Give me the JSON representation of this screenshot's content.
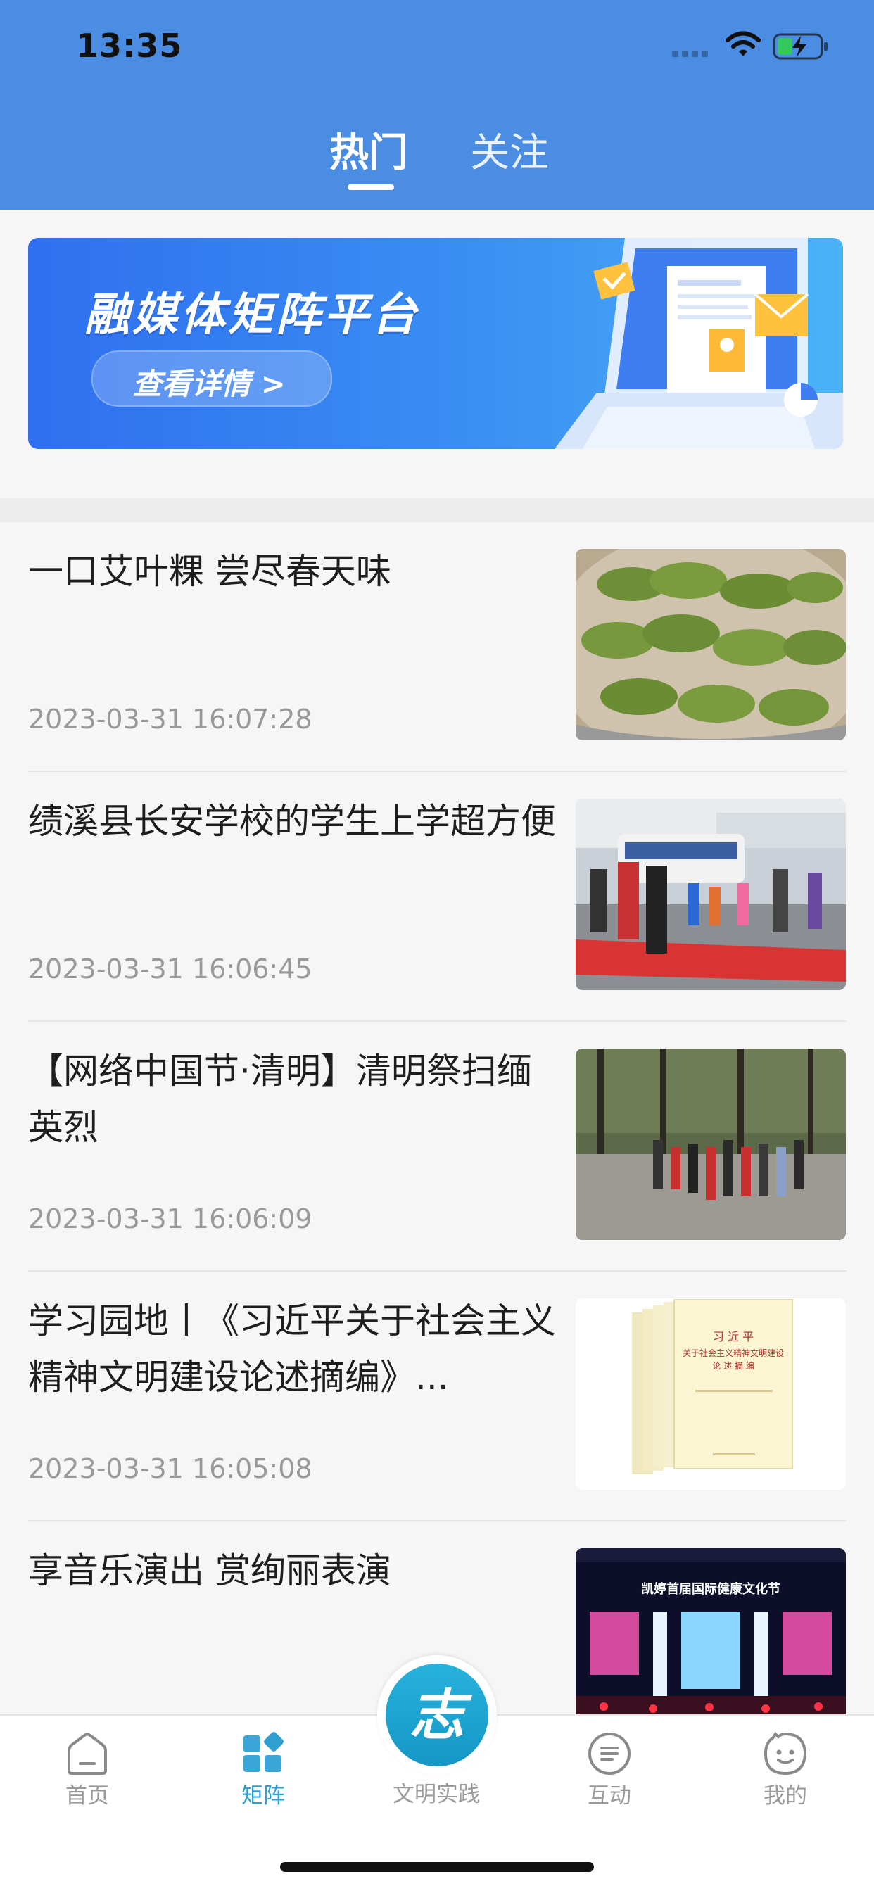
{
  "status": {
    "time": "13:35"
  },
  "header": {
    "tabs": [
      {
        "label": "热门"
      },
      {
        "label": "关注"
      }
    ],
    "active_tab": "热门"
  },
  "banner": {
    "title": "融媒体矩阵平台",
    "button": "查看详情 >"
  },
  "feed": [
    {
      "title": "一口艾叶粿 尝尽春天味",
      "time": "2023-03-31 16:07:28"
    },
    {
      "title": "绩溪县长安学校的学生上学超方便",
      "time": "2023-03-31 16:06:45"
    },
    {
      "title": "【网络中国节·清明】清明祭扫缅英烈",
      "time": "2023-03-31 16:06:09"
    },
    {
      "title": "学习园地丨《习近平关于社会主义精神文明建设论述摘编》...",
      "time": "2023-03-31 16:05:08"
    },
    {
      "title": "享音乐演出 赏绚丽表演",
      "time": ""
    }
  ],
  "thumbs": {
    "book_cover_title": "习 近 平",
    "book_cover_subtitle": "关于社会主义精神文明建设",
    "book_cover_line3": "论 述 摘 编",
    "stage_banner": "凯婷首届国际健康文化节"
  },
  "tabbar": {
    "items": [
      {
        "label": "首页",
        "icon": "home-icon"
      },
      {
        "label": "矩阵",
        "icon": "matrix-icon"
      },
      {
        "label": "文明实践",
        "icon": "zhi-icon"
      },
      {
        "label": "互动",
        "icon": "chat-icon"
      },
      {
        "label": "我的",
        "icon": "smiley-icon"
      }
    ],
    "active": "矩阵",
    "center_glyph": "志"
  },
  "colors": {
    "header": "#4b8de2",
    "active": "#2f9fd2",
    "muted": "#9a9a9a"
  }
}
